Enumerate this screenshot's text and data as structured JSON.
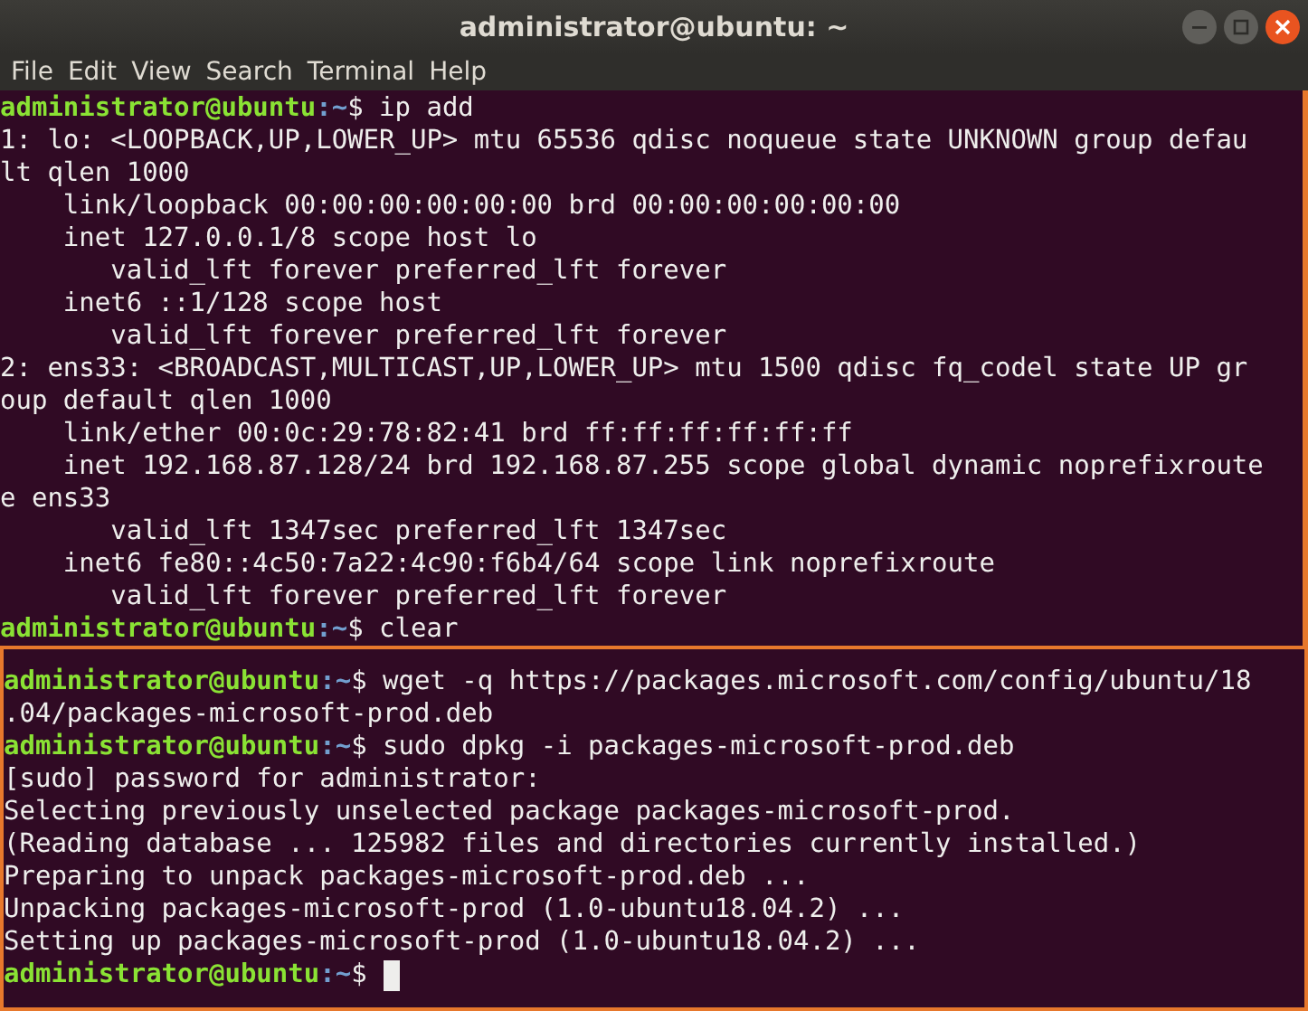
{
  "window": {
    "title": "administrator@ubuntu: ~"
  },
  "menu": [
    "File",
    "Edit",
    "View",
    "Search",
    "Terminal",
    "Help"
  ],
  "sections": [
    {
      "kind": "side",
      "lines": [
        {
          "kind": "prompt",
          "user": "administrator@ubuntu",
          "path": ":~",
          "command": "$ ip add"
        },
        {
          "kind": "output",
          "text": "1: lo: <LOOPBACK,UP,LOWER_UP> mtu 65536 qdisc noqueue state UNKNOWN group defau"
        },
        {
          "kind": "output",
          "text": "lt qlen 1000"
        },
        {
          "kind": "output",
          "text": "    link/loopback 00:00:00:00:00:00 brd 00:00:00:00:00:00"
        },
        {
          "kind": "output",
          "text": "    inet 127.0.0.1/8 scope host lo"
        },
        {
          "kind": "output",
          "text": "       valid_lft forever preferred_lft forever"
        },
        {
          "kind": "output",
          "text": "    inet6 ::1/128 scope host"
        },
        {
          "kind": "output",
          "text": "       valid_lft forever preferred_lft forever"
        },
        {
          "kind": "output",
          "text": "2: ens33: <BROADCAST,MULTICAST,UP,LOWER_UP> mtu 1500 qdisc fq_codel state UP gr"
        },
        {
          "kind": "output",
          "text": "oup default qlen 1000"
        },
        {
          "kind": "output",
          "text": "    link/ether 00:0c:29:78:82:41 brd ff:ff:ff:ff:ff:ff"
        },
        {
          "kind": "output",
          "text": "    inet 192.168.87.128/24 brd 192.168.87.255 scope global dynamic noprefixroute"
        },
        {
          "kind": "output",
          "text": "e ens33"
        },
        {
          "kind": "output",
          "text": "       valid_lft 1347sec preferred_lft 1347sec"
        },
        {
          "kind": "output",
          "text": "    inet6 fe80::4c50:7a22:4c90:f6b4/64 scope link noprefixroute"
        },
        {
          "kind": "output",
          "text": "       valid_lft forever preferred_lft forever"
        },
        {
          "kind": "prompt",
          "user": "administrator@ubuntu",
          "path": ":~",
          "command": "$ clear"
        }
      ]
    },
    {
      "kind": "full",
      "lines": [
        {
          "kind": "blank"
        },
        {
          "kind": "prompt",
          "user": "administrator@ubuntu",
          "path": ":~",
          "command": "$ wget -q https://packages.microsoft.com/config/ubuntu/18"
        },
        {
          "kind": "output",
          "text": ".04/packages-microsoft-prod.deb"
        },
        {
          "kind": "prompt",
          "user": "administrator@ubuntu",
          "path": ":~",
          "command": "$ sudo dpkg -i packages-microsoft-prod.deb"
        },
        {
          "kind": "output",
          "text": "[sudo] password for administrator:"
        },
        {
          "kind": "output",
          "text": "Selecting previously unselected package packages-microsoft-prod."
        },
        {
          "kind": "output",
          "text": "(Reading database ... 125982 files and directories currently installed.)"
        },
        {
          "kind": "output",
          "text": "Preparing to unpack packages-microsoft-prod.deb ..."
        },
        {
          "kind": "output",
          "text": "Unpacking packages-microsoft-prod (1.0-ubuntu18.04.2) ..."
        },
        {
          "kind": "output",
          "text": "Setting up packages-microsoft-prod (1.0-ubuntu18.04.2) ..."
        },
        {
          "kind": "prompt",
          "user": "administrator@ubuntu",
          "path": ":~",
          "command": "$",
          "cursor": true
        }
      ]
    }
  ]
}
